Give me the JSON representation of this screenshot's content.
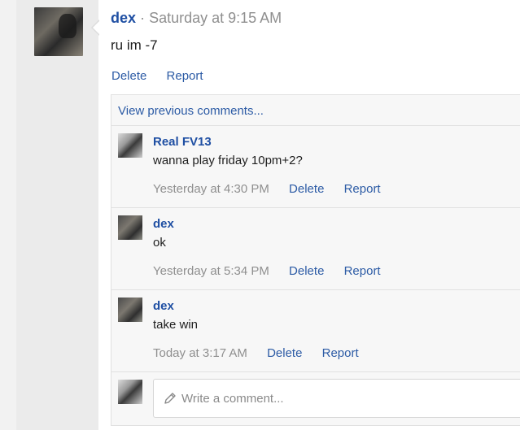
{
  "post": {
    "author": "dex",
    "separator": "·",
    "time": "Saturday at 9:15 AM",
    "body": "ru im -7",
    "actions": {
      "delete": "Delete",
      "report": "Report"
    }
  },
  "comments_section": {
    "view_previous": "View previous comments...",
    "comments": [
      {
        "author": "Real FV13",
        "text": "wanna play friday 10pm+2?",
        "time": "Yesterday at 4:30 PM",
        "delete": "Delete",
        "report": "Report"
      },
      {
        "author": "dex",
        "text": "ok",
        "time": "Yesterday at 5:34 PM",
        "delete": "Delete",
        "report": "Report"
      },
      {
        "author": "dex",
        "text": "take win",
        "time": "Today at 3:17 AM",
        "delete": "Delete",
        "report": "Report"
      }
    ],
    "write_placeholder": "Write a comment...",
    "write_icon": "pencil-icon"
  },
  "colors": {
    "link": "#2c5ba5",
    "author": "#1f4fa3",
    "muted": "#8f8f8f"
  }
}
